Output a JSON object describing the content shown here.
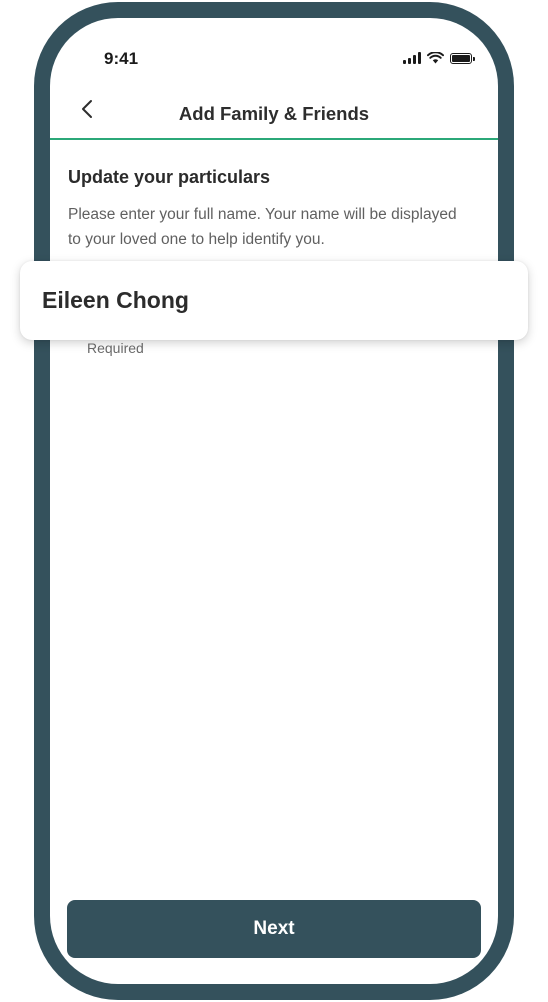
{
  "status_bar": {
    "time": "9:41",
    "icons": [
      "signal-icon",
      "wifi-icon",
      "battery-icon"
    ]
  },
  "nav": {
    "title": "Add Family & Friends",
    "back_icon": "chevron-left-icon"
  },
  "form": {
    "heading": "Update your particulars",
    "description": "Please enter your full name. Your name will be displayed to your loved one to help identify you.",
    "name_value": "Eileen Chong",
    "helper": "Required"
  },
  "footer": {
    "next_label": "Next"
  },
  "colors": {
    "frame": "#34515c",
    "accent_line": "#2ba878",
    "button_bg": "#34515c",
    "button_text": "#ffffff"
  }
}
